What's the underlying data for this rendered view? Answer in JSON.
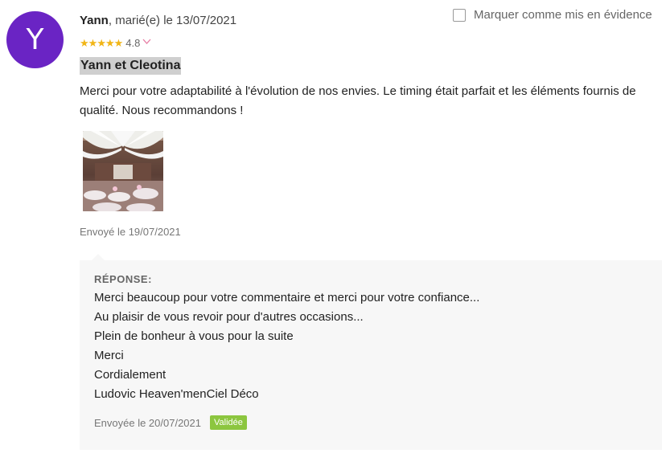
{
  "review": {
    "avatar_letter": "Y",
    "author": "Yann",
    "meta": ", marié(e) le 13/07/2021",
    "rating": "4.8",
    "title": "Yann et Cleotina",
    "body": "Merci pour votre adaptabilité à l'évolution de nos envies. Le timing était parfait et les éléments fournis de qualité. Nous recommandons !",
    "sent": "Envoyé le 19/07/2021",
    "feature_label": "Marquer comme mis en évidence"
  },
  "reply": {
    "label": "RÉPONSE:",
    "lines": [
      "Merci beaucoup pour votre commentaire et merci pour votre confiance...",
      "Au plaisir de vous revoir pour d'autres occasions...",
      "Plein de bonheur à vous pour la suite",
      "Merci",
      "Cordialement",
      "Ludovic Heaven'menCiel Déco"
    ],
    "sent": "Envoyée le 20/07/2021",
    "status_badge": "Validée"
  },
  "colors": {
    "avatar": "#6a24c4",
    "star": "#f1b516",
    "badge": "#8cc63f",
    "chevron": "#e77ca3"
  }
}
